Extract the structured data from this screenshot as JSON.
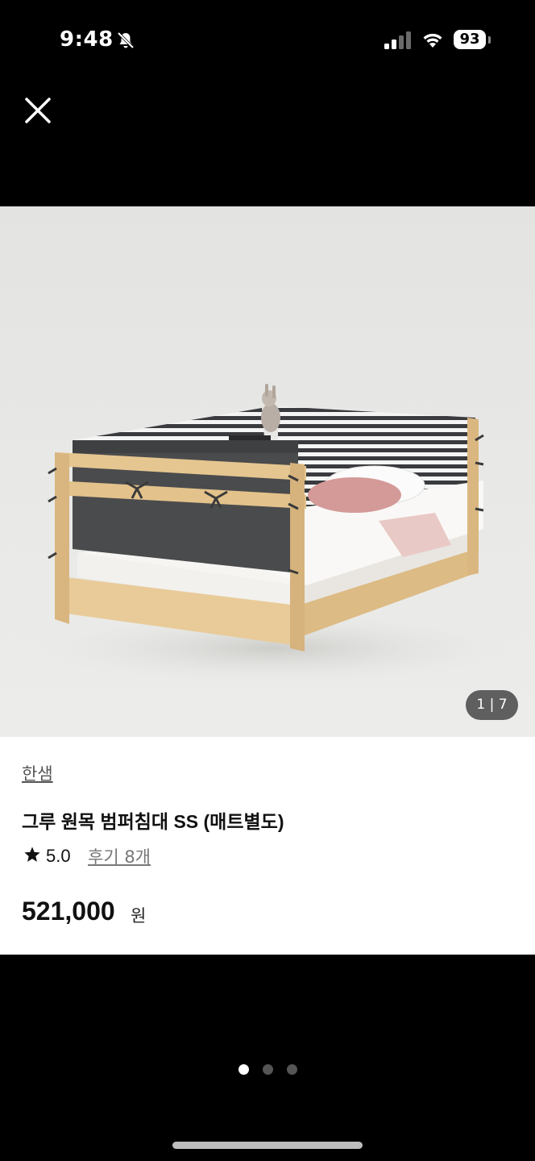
{
  "status_bar": {
    "time": "9:48",
    "battery": "93",
    "icons": [
      "bell-slash-icon",
      "cellular-signal-icon",
      "wifi-icon",
      "battery-icon"
    ]
  },
  "close_icon": "close-icon",
  "product": {
    "image_counter": "1 | 7",
    "brand": "한샘",
    "title": "그루 원목 범퍼침대 SS (매트별도)",
    "rating": "5.0",
    "review_link": "후기 8개",
    "price": "521,000",
    "price_unit": "원"
  },
  "pagination": {
    "count": 3,
    "active_index": 0
  },
  "colors": {
    "background": "#000000",
    "card": "#ffffff",
    "wood": "#e6c690",
    "bumper_dark": "#4a4b4d"
  }
}
